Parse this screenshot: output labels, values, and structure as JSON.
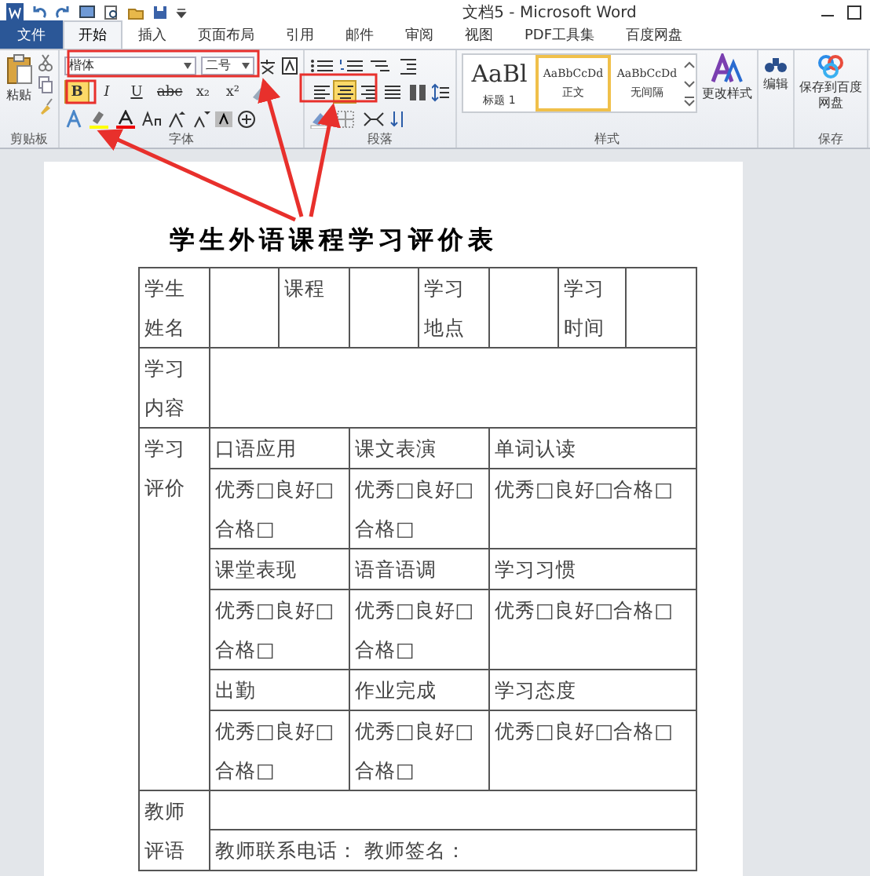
{
  "window": {
    "title": "文档5 - Microsoft Word"
  },
  "tabs": [
    {
      "label": "文件",
      "kind": "file",
      "selected": false
    },
    {
      "label": "开始",
      "kind": "tab",
      "selected": true
    },
    {
      "label": "插入",
      "kind": "tab",
      "selected": false
    },
    {
      "label": "页面布局",
      "kind": "tab",
      "selected": false
    },
    {
      "label": "引用",
      "kind": "tab",
      "selected": false
    },
    {
      "label": "邮件",
      "kind": "tab",
      "selected": false
    },
    {
      "label": "审阅",
      "kind": "tab",
      "selected": false
    },
    {
      "label": "视图",
      "kind": "tab",
      "selected": false
    },
    {
      "label": "PDF工具集",
      "kind": "tab",
      "selected": false
    },
    {
      "label": "百度网盘",
      "kind": "tab",
      "selected": false
    }
  ],
  "ribbon": {
    "clipboard": {
      "paste": "粘贴",
      "group": "剪贴板"
    },
    "font": {
      "family": "楷体",
      "size": "二号",
      "group": "字体",
      "buttons": [
        {
          "label": "B",
          "kind": "bold",
          "selected": true
        },
        {
          "label": "I",
          "kind": "italic",
          "selected": false
        },
        {
          "label": "U",
          "kind": "underline",
          "selected": false
        },
        {
          "label": "abc",
          "kind": "strike",
          "selected": false
        },
        {
          "label": "x₂",
          "kind": "plain",
          "selected": false
        },
        {
          "label": "x²",
          "kind": "plain",
          "selected": false
        }
      ]
    },
    "paragraph": {
      "group": "段落",
      "align": [
        {
          "kind": "left",
          "selected": false
        },
        {
          "kind": "center",
          "selected": true
        },
        {
          "kind": "right",
          "selected": false
        },
        {
          "kind": "justify",
          "selected": false
        }
      ]
    },
    "styles": {
      "group": "样式",
      "items": [
        {
          "preview": "AaBl",
          "name": "标题 1",
          "selected": false
        },
        {
          "preview": "AaBbCcDd",
          "name": "正文",
          "selected": true
        },
        {
          "preview": "AaBbCcDd",
          "name": "无间隔",
          "selected": false
        }
      ],
      "change": "更改样式"
    },
    "editing": {
      "label": "编辑"
    },
    "save": {
      "label": "保存到百度网盘",
      "group": "保存"
    }
  },
  "document": {
    "title": "学生外语课程学习评价表",
    "table": {
      "info": [
        "学生姓名",
        "课程",
        "学习地点",
        "学习时间"
      ],
      "content": "学习内容",
      "evaluation": {
        "label": "学习评价",
        "items": [
          {
            "name": "口语应用",
            "rating": "优秀□良好□合格□"
          },
          {
            "name": "课文表演",
            "rating": "优秀□良好□合格□"
          },
          {
            "name": "单词认读",
            "rating": "优秀□良好□合格□"
          },
          {
            "name": "课堂表现",
            "rating": "优秀□良好□合格□"
          },
          {
            "name": "语音语调",
            "rating": "优秀□良好□合格□"
          },
          {
            "name": "学习习惯",
            "rating": "优秀□良好□合格□"
          },
          {
            "name": "出勤",
            "rating": "优秀□良好□合格□"
          },
          {
            "name": "作业完成",
            "rating": "优秀□良好□合格□"
          },
          {
            "name": "学习态度",
            "rating": "优秀□良好□合格□"
          }
        ]
      },
      "teacher": {
        "label": "教师评语",
        "contact": "教师联系电话： 教师签名："
      }
    }
  }
}
